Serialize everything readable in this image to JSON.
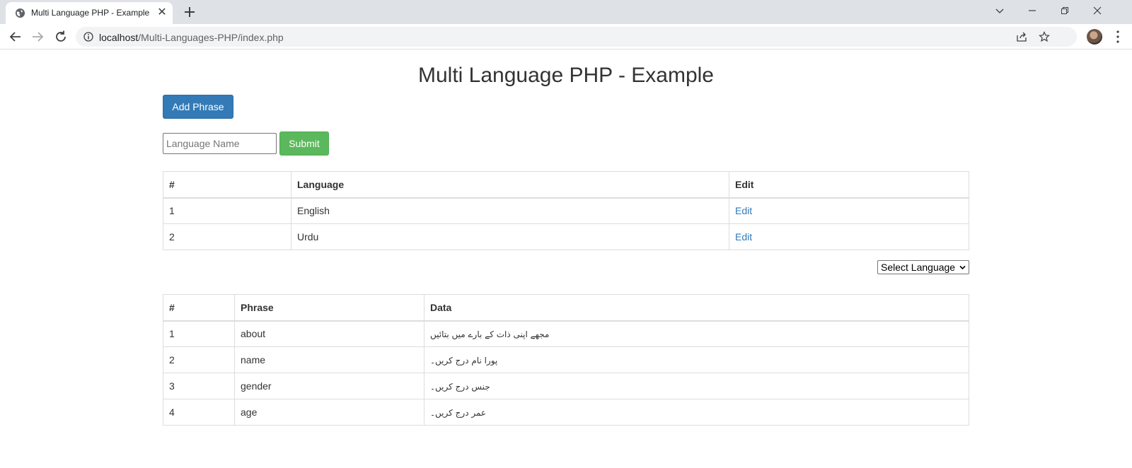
{
  "browser": {
    "tab_title": "Multi Language PHP - Example",
    "url_host": "localhost",
    "url_path": "/Multi-Languages-PHP/index.php"
  },
  "page": {
    "heading": "Multi Language PHP - Example",
    "add_phrase_label": "Add Phrase",
    "language_name_placeholder": "Language Name",
    "submit_label": "Submit",
    "select_language_label": "Select Language"
  },
  "languages_table": {
    "headers": [
      "#",
      "Language",
      "Edit"
    ],
    "rows": [
      {
        "num": "1",
        "language": "English",
        "edit": "Edit"
      },
      {
        "num": "2",
        "language": "Urdu",
        "edit": "Edit"
      }
    ]
  },
  "phrases_table": {
    "headers": [
      "#",
      "Phrase",
      "Data"
    ],
    "rows": [
      {
        "num": "1",
        "phrase": "about",
        "data": "مجھے اپنی ذات کے بارے میں بتائیں"
      },
      {
        "num": "2",
        "phrase": "name",
        "data": "پورا نام درج کریں۔"
      },
      {
        "num": "3",
        "phrase": "gender",
        "data": "جنس درج کریں۔"
      },
      {
        "num": "4",
        "phrase": "age",
        "data": "عمر درج کریں۔"
      }
    ]
  },
  "colors": {
    "primary": "#337ab7",
    "success": "#5cb85c",
    "link": "#337ab7"
  }
}
